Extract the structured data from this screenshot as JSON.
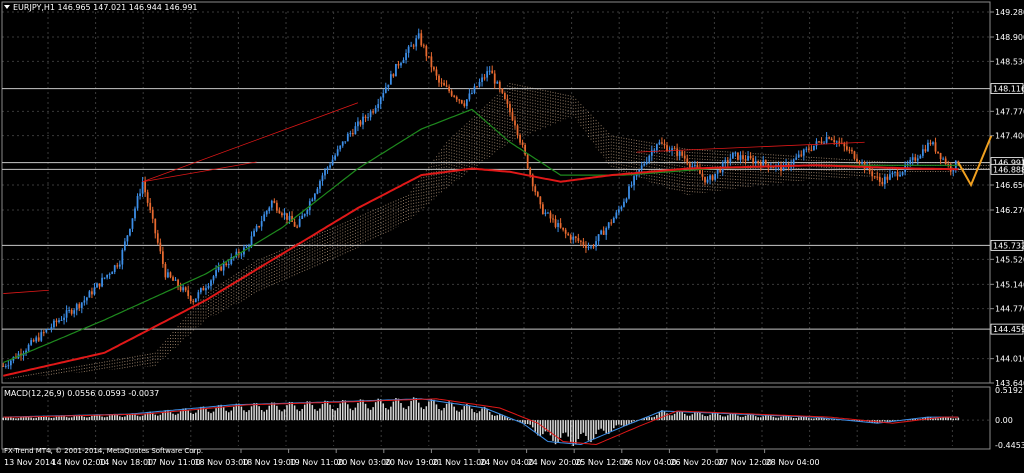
{
  "colors": {
    "background": "#000000",
    "grid": "#3a3a3a",
    "text": "#ffffff",
    "bull": "#3d8fe8",
    "bear": "#e86a30",
    "ma_red": "#e01818",
    "ma_green": "#1e8a1e",
    "cloud": "#c9a98a",
    "hline": "#c8c8c8",
    "macd_line": "#3d8fe8",
    "macd_signal": "#e01818",
    "macd_hist": "#d8d8d8",
    "projection": "#f0a020"
  },
  "header": {
    "text": "EURJPY,H1  146.965 147.021 146.944 146.991",
    "menu_icon": "triangle-down-icon"
  },
  "macd_header": {
    "text": "MACD(12,26,9) 0.0556 0.0593 -0.0037"
  },
  "watermark": {
    "text": "FX-Trend MT4, © 2001-2014, MetaQuotes Software Corp."
  },
  "price_axis_labels": [
    "149.280",
    "148.900",
    "148.530",
    "147.770",
    "147.400",
    "146.650",
    "146.270",
    "145.520",
    "145.140",
    "144.770",
    "144.010",
    "143.640"
  ],
  "price_tags": [
    {
      "text": "148.116",
      "value": 148.116,
      "style": "line"
    },
    {
      "text": "146.991",
      "value": 146.991,
      "style": "line"
    },
    {
      "text": "146.888",
      "value": 146.888,
      "style": "line"
    },
    {
      "text": "145.732",
      "value": 145.732,
      "style": "line"
    },
    {
      "text": "144.459",
      "value": 144.459,
      "style": "line"
    }
  ],
  "macd_axis_labels": [
    "0.5192",
    "0.00",
    "-0.4453"
  ],
  "time_axis_labels": [
    "13 Nov 2014",
    "14 Nov 02:00",
    "14 Nov 18:00",
    "17 Nov 11:00",
    "18 Nov 03:00",
    "18 Nov 19:00",
    "19 Nov 11:00",
    "20 Nov 03:00",
    "20 Nov 19:00",
    "21 Nov 11:00",
    "24 Nov 04:00",
    "24 Nov 20:00",
    "25 Nov 12:00",
    "26 Nov 04:00",
    "26 Nov 20:00",
    "27 Nov 12:00",
    "28 Nov 04:00"
  ],
  "chart_data": {
    "type": "candlestick",
    "symbol": "EURJPY",
    "timeframe": "H1",
    "ohlc_current": {
      "open": 146.965,
      "high": 147.021,
      "low": 146.944,
      "close": 146.991
    },
    "y_range": [
      143.64,
      149.28
    ],
    "grid": true,
    "close_path_anchors": [
      [
        0,
        143.9
      ],
      [
        10,
        144.2
      ],
      [
        22,
        144.6
      ],
      [
        32,
        144.9
      ],
      [
        46,
        145.5
      ],
      [
        55,
        146.7
      ],
      [
        64,
        145.3
      ],
      [
        75,
        144.9
      ],
      [
        86,
        145.4
      ],
      [
        96,
        145.7
      ],
      [
        106,
        146.4
      ],
      [
        116,
        146.0
      ],
      [
        126,
        146.8
      ],
      [
        136,
        147.4
      ],
      [
        146,
        147.8
      ],
      [
        156,
        148.5
      ],
      [
        164,
        148.9
      ],
      [
        172,
        148.2
      ],
      [
        182,
        147.9
      ],
      [
        192,
        148.4
      ],
      [
        202,
        147.6
      ],
      [
        212,
        146.3
      ],
      [
        222,
        145.9
      ],
      [
        232,
        145.7
      ],
      [
        242,
        146.2
      ],
      [
        250,
        146.8
      ],
      [
        258,
        147.3
      ],
      [
        268,
        147.1
      ],
      [
        278,
        146.7
      ],
      [
        288,
        147.1
      ],
      [
        298,
        147.0
      ],
      [
        308,
        146.9
      ],
      [
        318,
        147.2
      ],
      [
        326,
        147.4
      ],
      [
        336,
        147.1
      ],
      [
        346,
        146.7
      ],
      [
        356,
        146.9
      ],
      [
        366,
        147.3
      ],
      [
        374,
        146.9
      ],
      [
        377,
        146.991
      ]
    ],
    "projection": [
      [
        377,
        146.991
      ],
      [
        382,
        146.65
      ],
      [
        390,
        147.4
      ]
    ],
    "ma_red_anchors": [
      [
        0,
        143.75
      ],
      [
        40,
        144.1
      ],
      [
        80,
        144.9
      ],
      [
        110,
        145.6
      ],
      [
        140,
        146.3
      ],
      [
        165,
        146.8
      ],
      [
        185,
        146.9
      ],
      [
        200,
        146.85
      ],
      [
        220,
        146.7
      ],
      [
        240,
        146.8
      ],
      [
        270,
        146.9
      ],
      [
        320,
        146.95
      ],
      [
        360,
        146.9
      ],
      [
        377,
        146.89
      ]
    ],
    "ma_green_anchors": [
      [
        0,
        143.95
      ],
      [
        40,
        144.6
      ],
      [
        80,
        145.3
      ],
      [
        110,
        146.0
      ],
      [
        140,
        146.9
      ],
      [
        165,
        147.5
      ],
      [
        185,
        147.8
      ],
      [
        200,
        147.3
      ],
      [
        220,
        146.8
      ],
      [
        245,
        146.8
      ],
      [
        280,
        146.9
      ],
      [
        320,
        146.95
      ],
      [
        360,
        146.95
      ],
      [
        377,
        146.95
      ]
    ],
    "cloud_a_anchors": [
      [
        0,
        143.7
      ],
      [
        60,
        144.1
      ],
      [
        80,
        145.0
      ],
      [
        100,
        145.5
      ],
      [
        130,
        146.0
      ],
      [
        160,
        146.5
      ],
      [
        175,
        147.3
      ],
      [
        200,
        148.2
      ],
      [
        225,
        148.0
      ],
      [
        240,
        147.4
      ],
      [
        270,
        147.2
      ],
      [
        310,
        147.1
      ],
      [
        350,
        147.0
      ],
      [
        400,
        147.0
      ]
    ],
    "cloud_b_anchors": [
      [
        0,
        143.7
      ],
      [
        60,
        143.9
      ],
      [
        80,
        144.6
      ],
      [
        100,
        145.0
      ],
      [
        130,
        145.5
      ],
      [
        160,
        146.1
      ],
      [
        175,
        146.6
      ],
      [
        200,
        147.3
      ],
      [
        225,
        147.7
      ],
      [
        240,
        146.9
      ],
      [
        270,
        146.5
      ],
      [
        310,
        146.7
      ],
      [
        350,
        146.8
      ],
      [
        400,
        146.9
      ]
    ],
    "macd": {
      "line": 0.0556,
      "signal": 0.0593,
      "histogram": -0.0037,
      "y_range": [
        -0.4453,
        0.5192
      ],
      "hist_anchors": [
        [
          0,
          0.05
        ],
        [
          50,
          0.1
        ],
        [
          90,
          0.25
        ],
        [
          130,
          0.3
        ],
        [
          165,
          0.35
        ],
        [
          190,
          0.2
        ],
        [
          205,
          -0.05
        ],
        [
          215,
          -0.35
        ],
        [
          228,
          -0.4
        ],
        [
          245,
          -0.1
        ],
        [
          260,
          0.15
        ],
        [
          290,
          0.1
        ],
        [
          320,
          0.05
        ],
        [
          345,
          -0.05
        ],
        [
          365,
          0.05
        ],
        [
          377,
          0.05
        ]
      ]
    }
  }
}
